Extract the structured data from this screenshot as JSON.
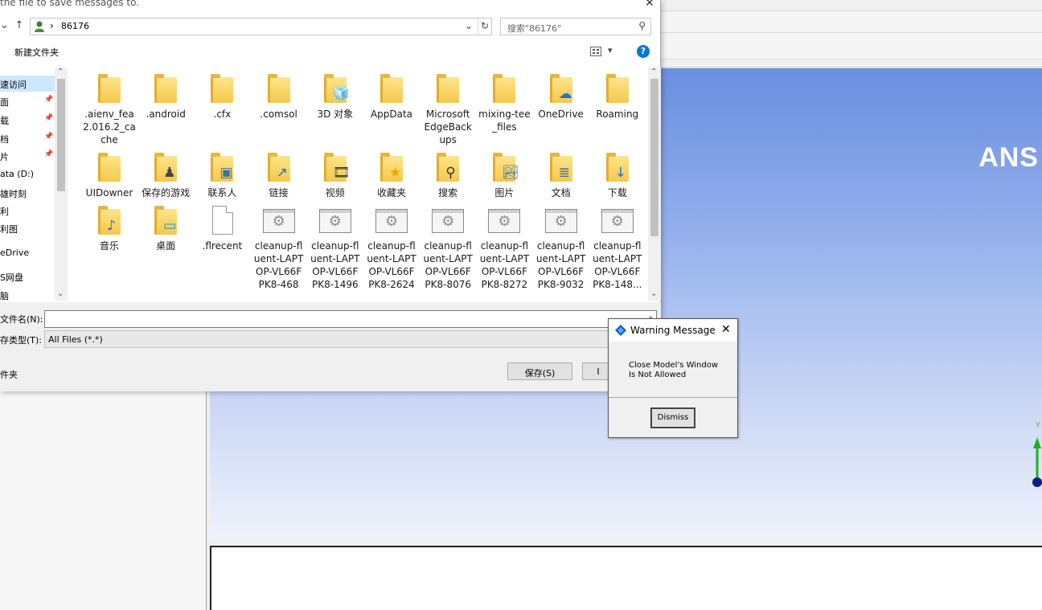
{
  "dialog": {
    "title": "the file to save messages to.",
    "close_glyph": "✕",
    "address": {
      "path_item": "86176",
      "separator": "›"
    },
    "search_placeholder": "搜索\"86176\"",
    "new_folder_label": "新建文件夹",
    "help_glyph": "?",
    "view_glyph": "▾",
    "nav_items": [
      {
        "label": "速访问",
        "pinned": false
      },
      {
        "label": "面",
        "pinned": true
      },
      {
        "label": "载",
        "pinned": true
      },
      {
        "label": "档",
        "pinned": true
      },
      {
        "label": "片",
        "pinned": true
      },
      {
        "label": "ata (D:)",
        "pinned": false
      },
      {
        "label": "雄时刻",
        "pinned": false
      },
      {
        "label": "利",
        "pinned": false
      },
      {
        "label": "利图",
        "pinned": false
      },
      {
        "label": "eDrive",
        "pinned": false
      },
      {
        "label": "S网盘",
        "pinned": false
      },
      {
        "label": "脑",
        "pinned": false
      }
    ],
    "files_row1": [
      {
        "name": ".aienv_fea2.016.2_cache",
        "lines": [
          ".aienv_fea",
          "2.016.2_ca",
          "che"
        ],
        "icon": "folder"
      },
      {
        "name": ".android",
        "lines": [
          ".android"
        ],
        "icon": "folder"
      },
      {
        "name": ".cfx",
        "lines": [
          ".cfx"
        ],
        "icon": "folder"
      },
      {
        "name": ".comsol",
        "lines": [
          ".comsol"
        ],
        "icon": "folder"
      },
      {
        "name": "3D 对象",
        "lines": [
          "3D 对象"
        ],
        "icon": "folder-3d"
      },
      {
        "name": "AppData",
        "lines": [
          "AppData"
        ],
        "icon": "folder"
      },
      {
        "name": "MicrosoftEdgeBackups",
        "lines": [
          "Microsoft",
          "EdgeBack",
          "ups"
        ],
        "icon": "folder"
      },
      {
        "name": "mixing-tee_files",
        "lines": [
          "mixing-tee",
          "_files"
        ],
        "icon": "folder"
      },
      {
        "name": "OneDrive",
        "lines": [
          "OneDrive"
        ],
        "icon": "folder-onedrive"
      },
      {
        "name": "Roaming",
        "lines": [
          "Roaming"
        ],
        "icon": "folder"
      }
    ],
    "files_row2": [
      {
        "name": "UIDowner",
        "lines": [
          "UIDowner"
        ],
        "icon": "folder"
      },
      {
        "name": "保存的游戏",
        "lines": [
          "保存的游戏"
        ],
        "icon": "folder-games"
      },
      {
        "name": "联系人",
        "lines": [
          "联系人"
        ],
        "icon": "folder-contacts"
      },
      {
        "name": "链接",
        "lines": [
          "链接"
        ],
        "icon": "folder-links"
      },
      {
        "name": "视频",
        "lines": [
          "视频"
        ],
        "icon": "folder-video"
      },
      {
        "name": "收藏夹",
        "lines": [
          "收藏夹"
        ],
        "icon": "folder-favorites"
      },
      {
        "name": "搜索",
        "lines": [
          "搜索"
        ],
        "icon": "folder-search"
      },
      {
        "name": "图片",
        "lines": [
          "图片"
        ],
        "icon": "folder-pictures"
      },
      {
        "name": "文档",
        "lines": [
          "文档"
        ],
        "icon": "folder-documents"
      },
      {
        "name": "下载",
        "lines": [
          "下载"
        ],
        "icon": "folder-downloads"
      }
    ],
    "files_row3": [
      {
        "name": "音乐",
        "lines": [
          "音乐"
        ],
        "icon": "folder-music"
      },
      {
        "name": "桌面",
        "lines": [
          "桌面"
        ],
        "icon": "folder-desktop"
      },
      {
        "name": ".flrecent",
        "lines": [
          ".flrecent"
        ],
        "icon": "document"
      },
      {
        "name": "cleanup-fluent-LAPTOP-VL66FPK8-468",
        "lines": [
          "cleanup-fl",
          "uent-LAPT",
          "OP-VL66F",
          "PK8-468"
        ],
        "icon": "app"
      },
      {
        "name": "cleanup-fluent-LAPTOP-VL66FPK8-1496",
        "lines": [
          "cleanup-fl",
          "uent-LAPT",
          "OP-VL66F",
          "PK8-1496"
        ],
        "icon": "app"
      },
      {
        "name": "cleanup-fluent-LAPTOP-VL66FPK8-2624",
        "lines": [
          "cleanup-fl",
          "uent-LAPT",
          "OP-VL66F",
          "PK8-2624"
        ],
        "icon": "app"
      },
      {
        "name": "cleanup-fluent-LAPTOP-VL66FPK8-8076",
        "lines": [
          "cleanup-fl",
          "uent-LAPT",
          "OP-VL66F",
          "PK8-8076"
        ],
        "icon": "app"
      },
      {
        "name": "cleanup-fluent-LAPTOP-VL66FPK8-8272",
        "lines": [
          "cleanup-fl",
          "uent-LAPT",
          "OP-VL66F",
          "PK8-8272"
        ],
        "icon": "app"
      },
      {
        "name": "cleanup-fluent-LAPTOP-VL66FPK8-9032",
        "lines": [
          "cleanup-fl",
          "uent-LAPT",
          "OP-VL66F",
          "PK8-9032"
        ],
        "icon": "app"
      },
      {
        "name": "cleanup-fluent-LAPTOP-VL66FPK8-148...",
        "lines": [
          "cleanup-fl",
          "uent-LAPT",
          "OP-VL66F",
          "PK8-148..."
        ],
        "icon": "app"
      }
    ],
    "filename_label": "文件名(N):",
    "filename_value": "",
    "filetype_label": "存类型(T):",
    "filetype_value": "All Files (*.*)",
    "hide_folders_label": "件夹",
    "save_button": "保存(S)",
    "cancel_button": "I"
  },
  "warning": {
    "title": "Warning Message",
    "close_glyph": "✕",
    "message": "Close Model's Window Is Not Allowed",
    "dismiss": "Dismiss"
  },
  "background": {
    "logo": "ANS"
  },
  "colors": {
    "accent": "#0078d7",
    "folder": "#f5c84c",
    "graphics_top": "#6a8fe0",
    "graphics_bottom": "#eef2fb"
  }
}
